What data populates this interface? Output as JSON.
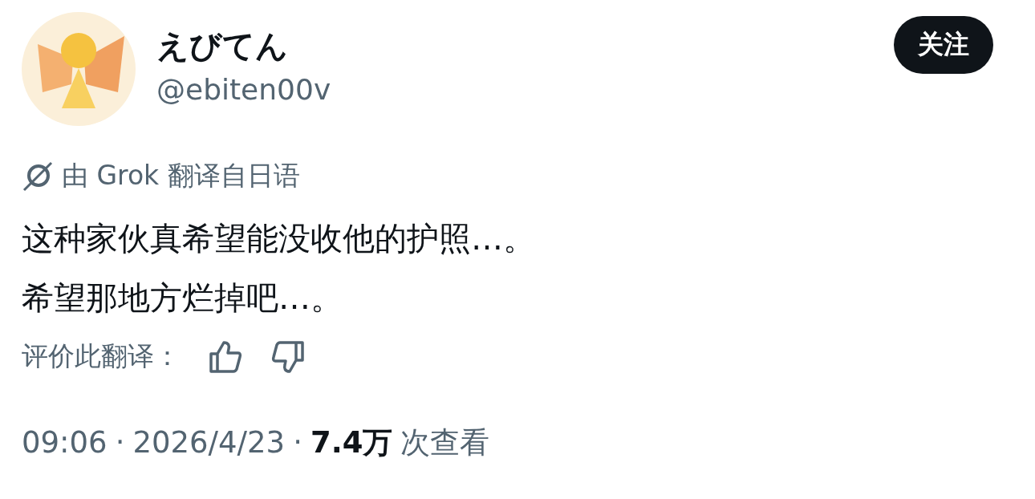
{
  "author": {
    "name": "えびてん",
    "handle": "@ebiten00v"
  },
  "follow_button": {
    "label": "关注"
  },
  "translation_note": "由 Grok 翻译自日语",
  "tweet_text": [
    "这种家伙真希望能没收他的护照…。",
    "希望那地方烂掉吧…。"
  ],
  "rate_translation": {
    "label": "评价此翻译："
  },
  "footer": {
    "time": "09:06",
    "separators": [
      "·",
      "·"
    ],
    "date": "2026/4/23",
    "views": "7.4万",
    "views_label": "次查看"
  }
}
